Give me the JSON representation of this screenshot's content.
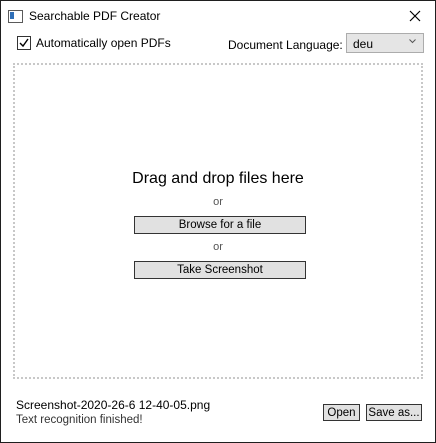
{
  "window": {
    "title": "Searchable PDF Creator",
    "close_icon": "close-icon"
  },
  "options": {
    "auto_open_label": "Automatically open PDFs",
    "auto_open_checked": true,
    "language_label": "Document Language:",
    "language_value": "deu"
  },
  "dropzone": {
    "title": "Drag and drop files here",
    "or_1": "or",
    "browse_label": "Browse for a file",
    "or_2": "or",
    "screenshot_label": "Take Screenshot"
  },
  "status": {
    "file_name": "Screenshot-2020-26-6 12-40-05.png",
    "message": "Text recognition finished!"
  },
  "actions": {
    "open_label": "Open",
    "save_as_label": "Save as..."
  }
}
